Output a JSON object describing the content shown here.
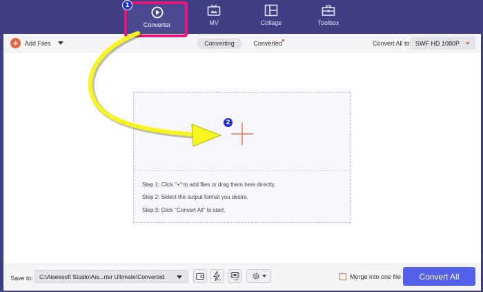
{
  "nav": {
    "tabs": [
      {
        "label": "Converter",
        "icon": "converter-icon",
        "active": true
      },
      {
        "label": "MV",
        "icon": "tv-icon",
        "active": false
      },
      {
        "label": "Collage",
        "icon": "collage-icon",
        "active": false
      },
      {
        "label": "Toolbox",
        "icon": "toolbox-icon",
        "active": false
      }
    ]
  },
  "annotations": {
    "badge1": "1",
    "badge2": "2",
    "highlight_color": "#e8157a",
    "arrow_color": "#f7f51e"
  },
  "toolbar": {
    "add_files_label": "Add Files",
    "converting_label": "Converting",
    "converted_label": "Converted",
    "convert_all_to_label": "Convert All to:",
    "format_value": "SWF HD 1080P"
  },
  "dropzone": {
    "step1": "Step 1: Click \"+\" to add files or drag them here directly.",
    "step2": "Step 2: Select the output format you desire.",
    "step3": "Step 3: Click \"Convert All\" to start."
  },
  "bottom": {
    "save_to_label": "Save to:",
    "save_path": "C:\\Aiseesoft Studio\\Ais...rter Ultimate\\Converted",
    "merge_label": "Merge into one file",
    "convert_all_label": "Convert All"
  },
  "colors": {
    "background": "#3e3f84",
    "accent": "#f0603a",
    "primary_button": "#5560ea"
  }
}
